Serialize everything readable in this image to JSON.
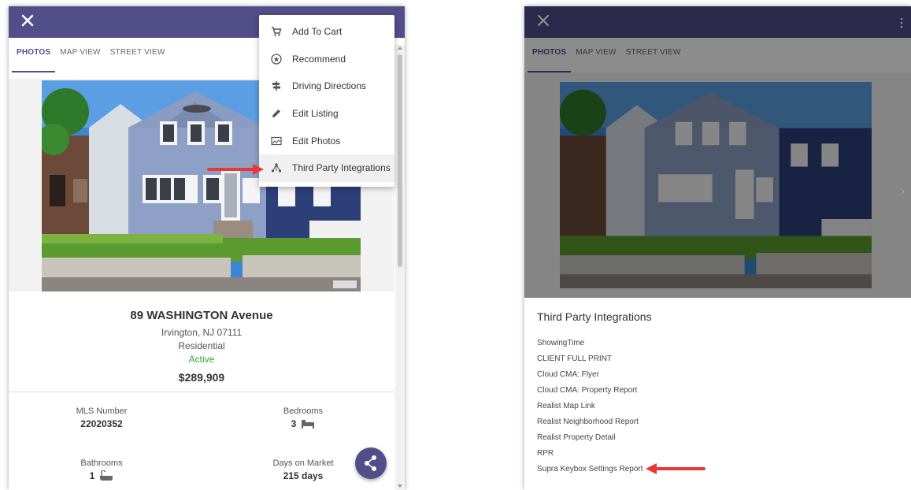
{
  "left": {
    "tabs": [
      {
        "label": "PHOTOS",
        "active": true
      },
      {
        "label": "MAP VIEW",
        "active": false
      },
      {
        "label": "STREET VIEW",
        "active": false
      }
    ],
    "menu": [
      {
        "label": "Add To Cart",
        "icon": "cart-icon"
      },
      {
        "label": "Recommend",
        "icon": "recommend-icon"
      },
      {
        "label": "Driving Directions",
        "icon": "signpost-icon"
      },
      {
        "label": "Edit Listing",
        "icon": "pencil-icon"
      },
      {
        "label": "Edit Photos",
        "icon": "photo-edit-icon"
      },
      {
        "label": "Third Party Integrations",
        "icon": "network-icon",
        "highlighted": true
      }
    ],
    "listing": {
      "address": "89 WASHINGTON Avenue",
      "city_line": "Irvington, NJ 07111",
      "type": "Residential",
      "status": "Active",
      "price": "$289,909"
    },
    "stats": {
      "mls_label": "MLS Number",
      "mls_value": "22020352",
      "bedrooms_label": "Bedrooms",
      "bedrooms_value": "3",
      "bathrooms_label": "Bathrooms",
      "bathrooms_value": "1",
      "dom_label": "Days on Market",
      "dom_value": "215 days"
    },
    "photo_watermark": "NJMLS"
  },
  "right": {
    "tabs": [
      {
        "label": "PHOTOS",
        "active": true
      },
      {
        "label": "MAP VIEW",
        "active": false
      },
      {
        "label": "STREET VIEW",
        "active": false
      }
    ],
    "dialog_title": "Third Party Integrations",
    "integrations": [
      "ShowingTime",
      "CLIENT FULL PRINT",
      "Cloud CMA: Flyer",
      "Cloud CMA: Property Report",
      "Realist Map Link",
      "Realist Neighborhood Report",
      "Realist Property Detail",
      "RPR",
      "Supra Keybox Settings Report"
    ]
  },
  "colors": {
    "header": "#514e8a",
    "status_active": "#2eaa2e",
    "annotation_arrow": "#e53935"
  }
}
